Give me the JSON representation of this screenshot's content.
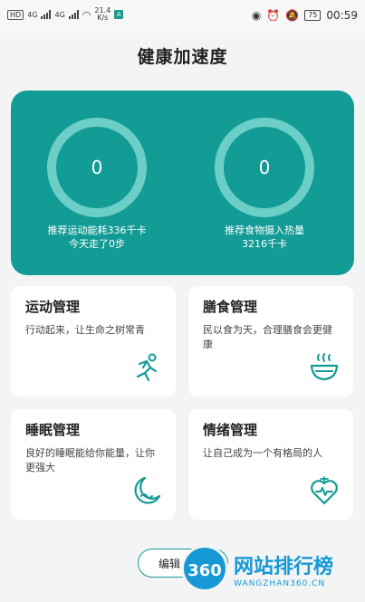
{
  "status_bar": {
    "left_chips": [
      "HD",
      "4G",
      "4G"
    ],
    "net_speed": "21.4",
    "net_unit": "K/s",
    "a_badge": "A",
    "battery": "75",
    "time": "00:59"
  },
  "page": {
    "title": "健康加速度"
  },
  "hero": {
    "left": {
      "value": "0",
      "caption_1": "推荐运动能耗336千卡",
      "caption_2": "今天走了0步"
    },
    "right": {
      "value": "0",
      "caption_1": "推荐食物摄入热量",
      "caption_2": "3216千卡"
    }
  },
  "cards": [
    {
      "title": "运动管理",
      "desc": "行动起来，让生命之树常青",
      "icon": "running-icon"
    },
    {
      "title": "膳食管理",
      "desc": "民以食为天，合理膳食会更健康",
      "icon": "bowl-icon"
    },
    {
      "title": "睡眠管理",
      "desc": "良好的睡眠能给你能量，让你更强大",
      "icon": "moon-icon"
    },
    {
      "title": "情绪管理",
      "desc": "让自己成为一个有格局的人",
      "icon": "heart-icon"
    }
  ],
  "footer": {
    "edit_label": "编辑"
  },
  "watermark": {
    "logo": "360",
    "text": "网站排行榜",
    "sub": "WANGZHAN360.CN"
  },
  "colors": {
    "primary": "#139b96",
    "ring": "#6ccfc7",
    "background": "#f3f4f4"
  }
}
